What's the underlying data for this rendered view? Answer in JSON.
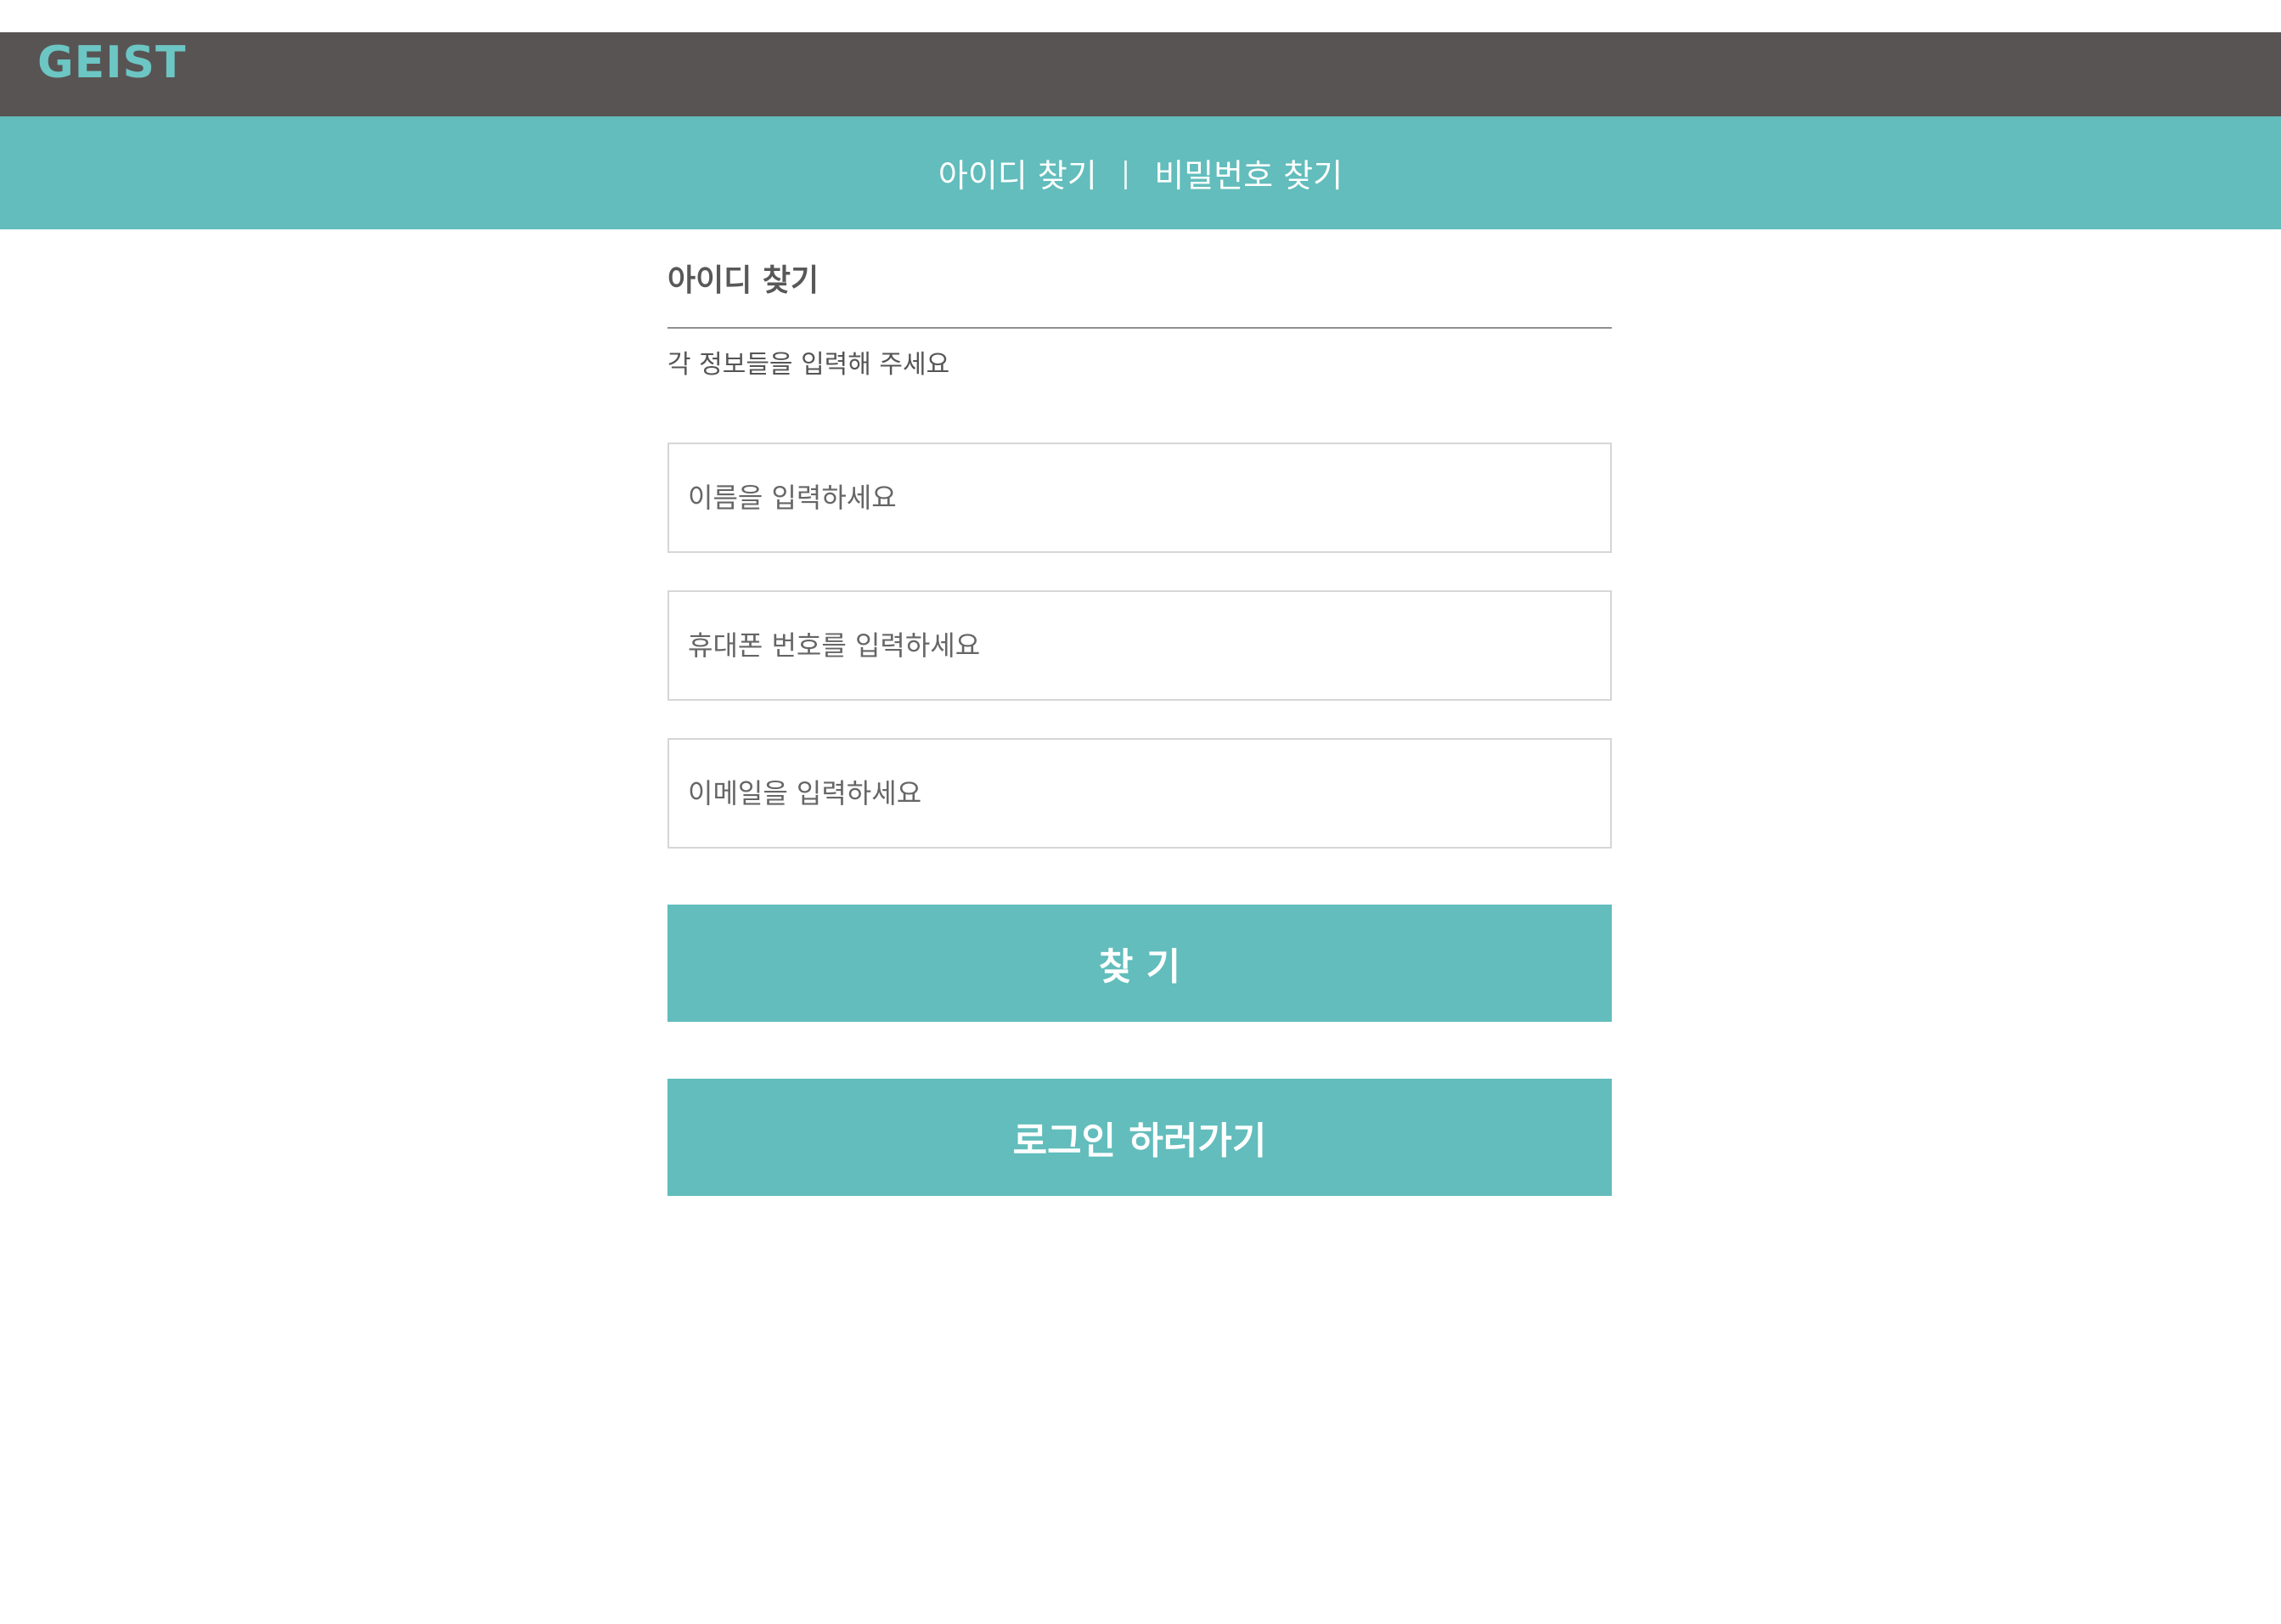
{
  "header": {
    "logo": "GEIST"
  },
  "nav": {
    "find_id": "아이디 찾기",
    "separator": "|",
    "find_password": "비밀번호 찾기"
  },
  "form": {
    "title": "아이디 찾기",
    "instruction": "각 정보들을 입력해 주세요",
    "name_placeholder": "이름을 입력하세요",
    "phone_placeholder": "휴대폰 번호를 입력하세요",
    "email_placeholder": "이메일을 입력하세요",
    "find_button": "찾 기",
    "login_button": "로그인 하러가기"
  },
  "colors": {
    "header_bg": "#585453",
    "accent": "#62bdbc",
    "logo": "#6cc6c4"
  }
}
